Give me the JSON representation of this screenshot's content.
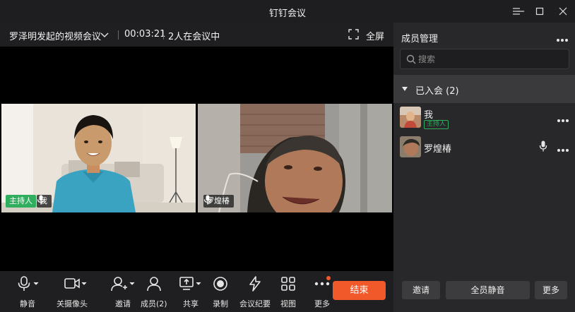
{
  "window": {
    "title": "钉钉会议"
  },
  "meeting": {
    "title": "罗泽明发起的视频会议",
    "timer": "00:03:21",
    "participants_text": "2人在会议中",
    "fullscreen_label": "全屏"
  },
  "videos": [
    {
      "host_badge": "主持人",
      "name": "我"
    },
    {
      "name": "罗煌椿"
    }
  ],
  "toolbar": {
    "mute": "静音",
    "camera": "关摄像头",
    "invite": "邀请",
    "members": "成员(2)",
    "share": "共享",
    "record": "录制",
    "minutes": "会议纪要",
    "view": "视图",
    "more": "更多",
    "end": "结束"
  },
  "panel": {
    "title": "成员管理",
    "search_placeholder": "搜索",
    "group_label": "已入会 (2)",
    "members": [
      {
        "name": "我",
        "tag": "主持人"
      },
      {
        "name": "罗煌椿"
      }
    ],
    "buttons": {
      "invite": "邀请",
      "mute_all": "全员静音",
      "more": "更多"
    }
  },
  "colors": {
    "accent_end": "#f1592a",
    "host_green": "#2fae5e",
    "panel_bg": "#28282a"
  }
}
